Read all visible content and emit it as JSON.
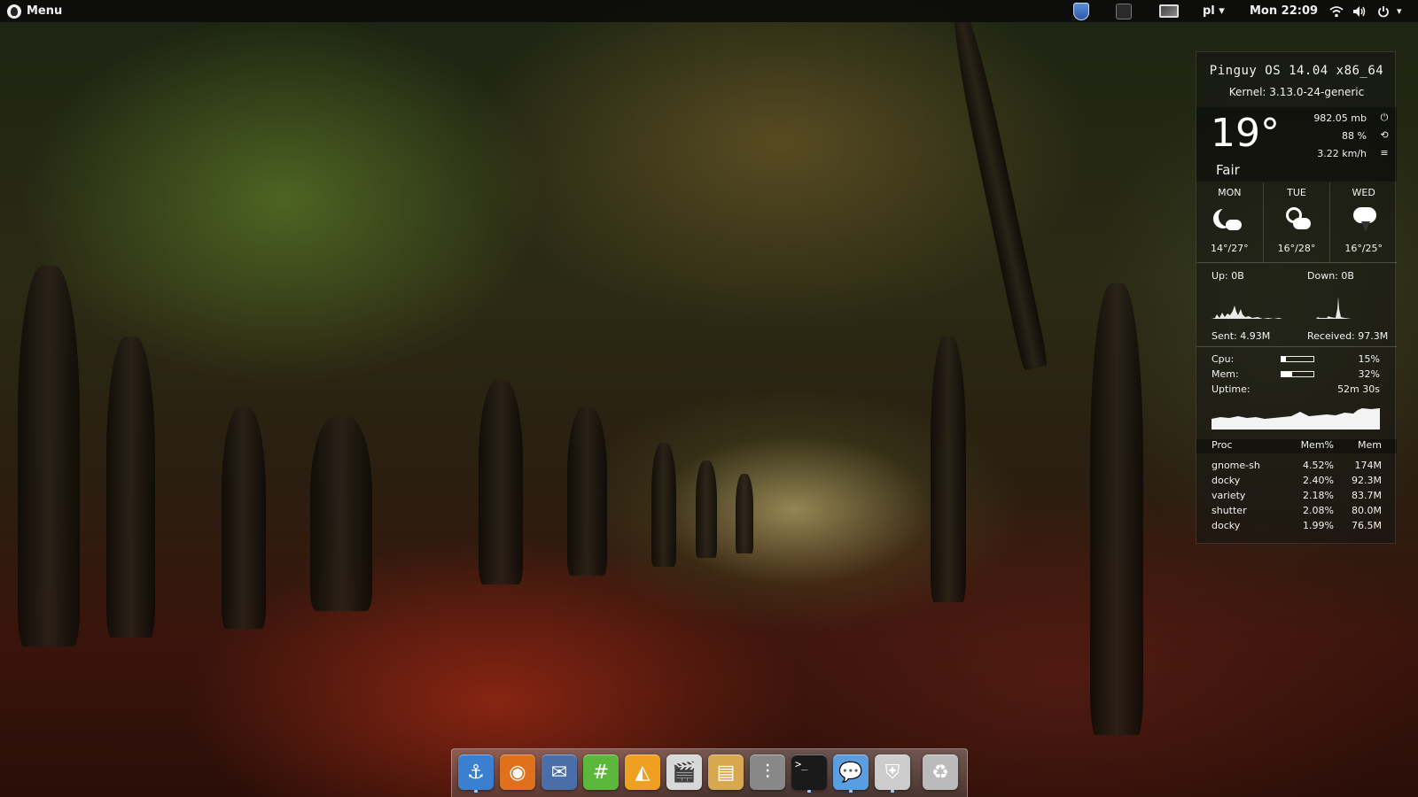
{
  "top_panel": {
    "menu_label": "Menu",
    "keyboard_layout": "pl ▾",
    "clock": "Mon 22:09",
    "wifi_icon": "wifi-icon",
    "volume_icon": "volume-icon",
    "power_icon": "power-icon",
    "power_arrow": "▾"
  },
  "conky": {
    "os_title": "Pinguy OS 14.04 x86_64",
    "kernel": "Kernel: 3.13.0-24-generic",
    "weather": {
      "temp": "19°",
      "condition": "Fair",
      "pressure": "982.05 mb",
      "humidity": "88 %",
      "wind": "3.22 km/h",
      "forecast": [
        {
          "day": "MON",
          "range": "14°/27°",
          "icon": "moon-cloud-icon"
        },
        {
          "day": "TUE",
          "range": "16°/28°",
          "icon": "sun-cloud-icon"
        },
        {
          "day": "WED",
          "range": "16°/25°",
          "icon": "storm-icon"
        }
      ]
    },
    "network": {
      "up": "Up: 0B",
      "down": "Down: 0B",
      "sent": "Sent: 4.93M",
      "received": "Received: 97.3M"
    },
    "system": {
      "cpu_label": "Cpu:",
      "cpu_value": "15%",
      "cpu_fraction": 0.15,
      "mem_label": "Mem:",
      "mem_value": "32%",
      "mem_fraction": 0.32,
      "uptime_label": "Uptime:",
      "uptime_value": "52m 30s"
    },
    "processes": {
      "headers": [
        "Proc",
        "Mem%",
        "Mem"
      ],
      "rows": [
        [
          "gnome-sh",
          "4.52%",
          "174M"
        ],
        [
          "docky",
          "2.40%",
          "92.3M"
        ],
        [
          "variety",
          "2.18%",
          "83.7M"
        ],
        [
          "shutter",
          "2.08%",
          "80.0M"
        ],
        [
          "docky",
          "1.99%",
          "76.5M"
        ]
      ]
    }
  },
  "dock": {
    "items": [
      {
        "name": "anchor-icon",
        "glyph": "⚓",
        "color": "#3a7fd0",
        "running": true
      },
      {
        "name": "firefox-icon",
        "glyph": "◉",
        "color": "#e0701c",
        "running": false
      },
      {
        "name": "thunderbird-icon",
        "glyph": "✉",
        "color": "#4a6ea8",
        "running": false
      },
      {
        "name": "hexchat-icon",
        "glyph": "#",
        "color": "#5cb83a",
        "running": false
      },
      {
        "name": "slideshow-icon",
        "glyph": "◭",
        "color": "#f0a020",
        "running": false
      },
      {
        "name": "video-editor-icon",
        "glyph": "🎬",
        "color": "#d8d8d8",
        "running": false
      },
      {
        "name": "archive-icon",
        "glyph": "▤",
        "color": "#d8a850",
        "running": false
      },
      {
        "name": "mixer-icon",
        "glyph": "⫶",
        "color": "#888888",
        "running": false
      },
      {
        "name": "terminal-icon",
        "glyph": ">_",
        "color": "#1a1a1a",
        "running": true
      },
      {
        "name": "chat-icon",
        "glyph": "💬",
        "color": "#5a9ee0",
        "running": true
      },
      {
        "name": "shield-icon",
        "glyph": "⛨",
        "color": "#cccccc",
        "running": true
      },
      {
        "name": "trash-icon",
        "glyph": "♻",
        "color": "#bbbbbb",
        "running": false
      }
    ]
  }
}
